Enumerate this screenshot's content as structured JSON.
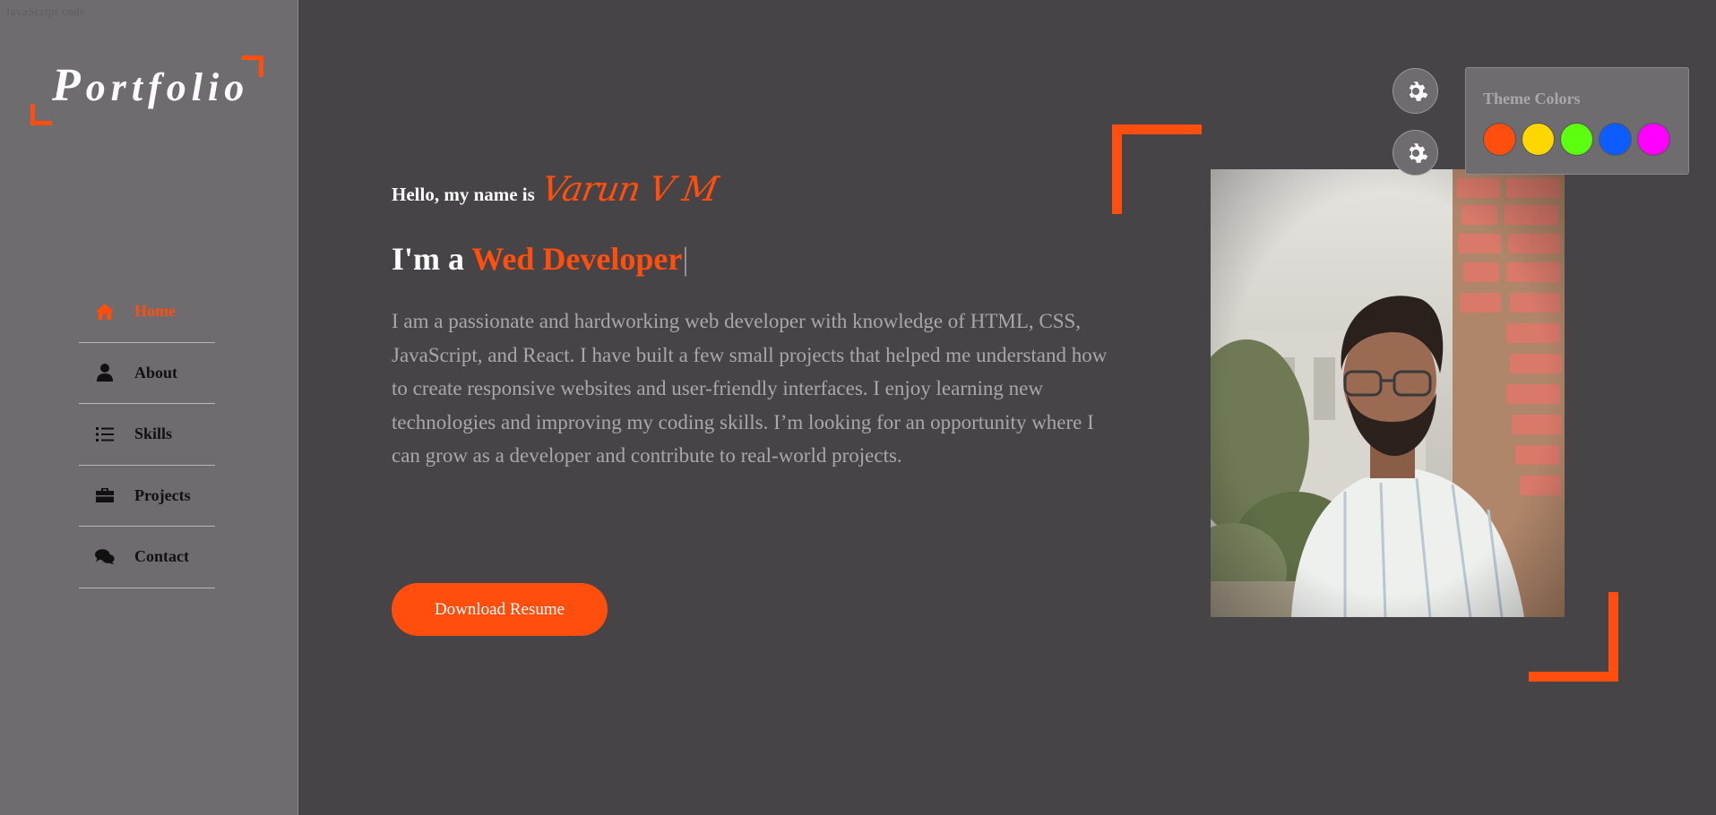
{
  "ghost_text": "JavaScript code",
  "logo": {
    "text_cap": "P",
    "text_rest": "ortfolio"
  },
  "nav": {
    "items": [
      {
        "label": "Home",
        "icon": "home-icon",
        "active": true
      },
      {
        "label": "About",
        "icon": "user-icon",
        "active": false
      },
      {
        "label": "Skills",
        "icon": "list-icon",
        "active": false
      },
      {
        "label": "Projects",
        "icon": "briefcase-icon",
        "active": false
      },
      {
        "label": "Contact",
        "icon": "comments-icon",
        "active": false
      }
    ]
  },
  "hero": {
    "greeting": "Hello, my name is",
    "name": "Varun V M",
    "role_prefix": "I'm a",
    "role_typed": "Wed Developer",
    "cursor": "|",
    "bio": "I am a passionate and hardworking web developer with knowledge of HTML, CSS, JavaScript, and React. I have built a few small projects that helped me understand how to create responsive websites and user-friendly interfaces. I enjoy learning new technologies and improving my coding skills. I’m looking for an opportunity where I can grow as a developer and contribute to real-world projects.",
    "resume_button": "Download Resume"
  },
  "settings": {
    "icon": "gear-icon",
    "theme_title": "Theme Colors",
    "swatches": [
      "#ff4e0d",
      "#ffd700",
      "#5cff0d",
      "#0d5cff",
      "#ff00ff"
    ]
  },
  "colors": {
    "accent": "#ff4e0d",
    "background": "#464446",
    "sidebar": "#6e6c6e"
  }
}
